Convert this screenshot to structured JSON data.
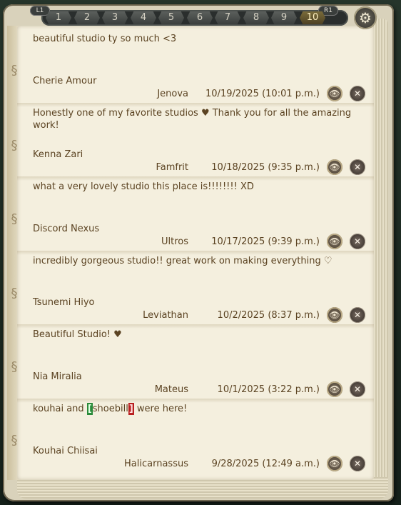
{
  "tabs": {
    "left_shoulder": "L1",
    "right_shoulder": "R1",
    "pages": [
      "1",
      "2",
      "3",
      "4",
      "5",
      "6",
      "7",
      "8",
      "9",
      "10"
    ],
    "active_index": 9
  },
  "entries": [
    {
      "message": "beautiful studio ty so much <3",
      "author": "Cherie Amour",
      "world": "Jenova",
      "date": "10/19/2025 (10:01 p.m.)"
    },
    {
      "message": "Honestly one of my favorite studios ♥ Thank you for all the amazing work!",
      "author": "Kenna Zari",
      "world": "Famfrit",
      "date": "10/18/2025 (9:35 p.m.)"
    },
    {
      "message": "what a very lovely studio this place is!!!!!!!! XD",
      "author": "Discord Nexus",
      "world": "Ultros",
      "date": "10/17/2025 (9:39 p.m.)"
    },
    {
      "message": "incredibly gorgeous studio!! great work on making everything ♡",
      "author": "Tsunemi Hiyo",
      "world": "Leviathan",
      "date": "10/2/2025 (8:37 p.m.)"
    },
    {
      "message": "Beautiful Studio! ♥",
      "author": "Nia Miralia",
      "world": "Mateus",
      "date": "10/1/2025 (3:22 p.m.)"
    },
    {
      "message_pre": "kouhai and ",
      "bracket_open": "[",
      "message_mid": "shoebill",
      "bracket_close": "]",
      "message_post": " were here!",
      "author": "Kouhai Chiisai",
      "world": "Halicarnassus",
      "date": "9/28/2025 (12:49 a.m.)"
    }
  ],
  "icons": {
    "view": "eye-icon",
    "delete": "close-icon",
    "settings": "gear-icon"
  }
}
